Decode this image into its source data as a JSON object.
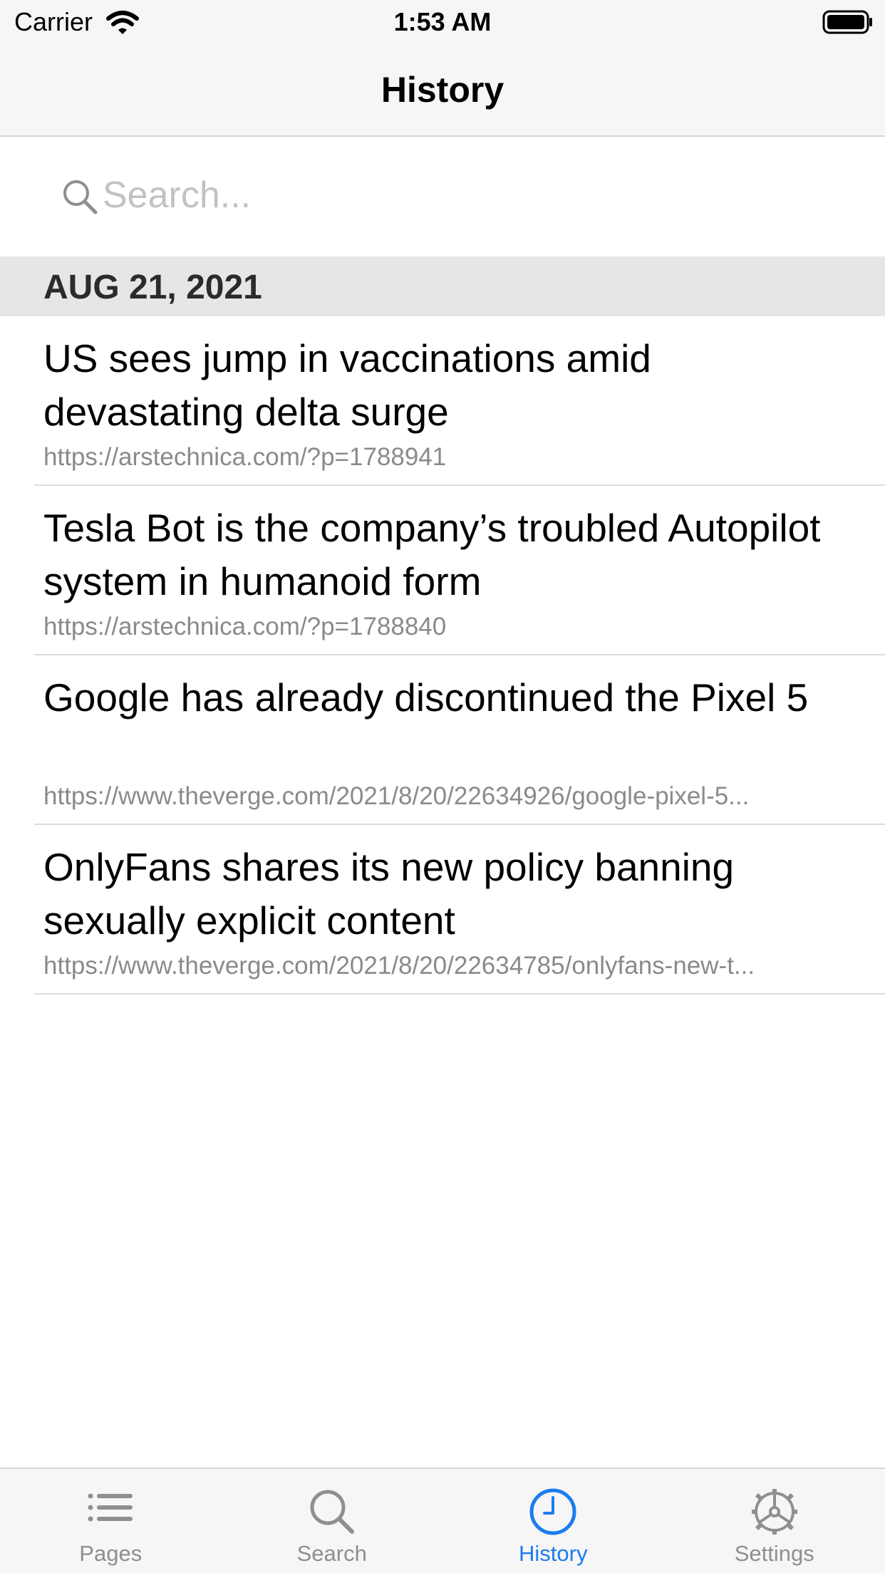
{
  "status_bar": {
    "carrier": "Carrier",
    "time": "1:53 AM"
  },
  "nav": {
    "title": "History"
  },
  "search": {
    "placeholder": "Search...",
    "value": ""
  },
  "section": {
    "date": "AUG 21, 2021"
  },
  "history_items": [
    {
      "title": "US sees jump in vaccinations amid devastating delta surge",
      "url": "https://arstechnica.com/?p=1788941"
    },
    {
      "title": "Tesla Bot is the company’s troubled Autopilot system in humanoid form",
      "url": "https://arstechnica.com/?p=1788840"
    },
    {
      "title": "Google has already discontinued the Pixel 5",
      "url": "https://www.theverge.com/2021/8/20/22634926/google-pixel-5..."
    },
    {
      "title": "OnlyFans shares its new policy banning sexually explicit content",
      "url": "https://www.theverge.com/2021/8/20/22634785/onlyfans-new-t..."
    }
  ],
  "tabbar": {
    "tabs": [
      {
        "label": "Pages",
        "icon": "list-icon",
        "active": false
      },
      {
        "label": "Search",
        "icon": "search-icon",
        "active": false
      },
      {
        "label": "History",
        "icon": "clock-icon",
        "active": true
      },
      {
        "label": "Settings",
        "icon": "gear-icon",
        "active": false
      }
    ]
  },
  "colors": {
    "accent": "#1a7cf0",
    "inactive_tab": "#8e8e93",
    "section_bg": "#e6e6e6",
    "url_text": "#8a8a8e"
  }
}
